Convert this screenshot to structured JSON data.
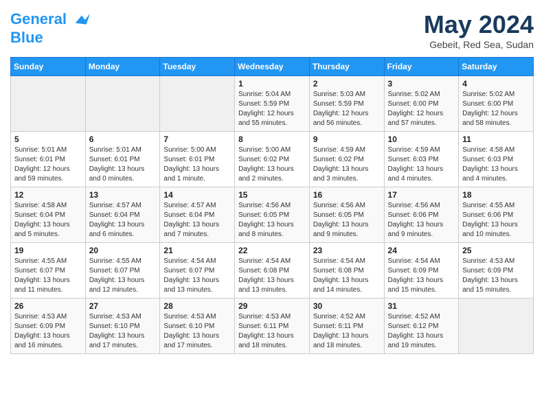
{
  "header": {
    "logo_line1": "General",
    "logo_line2": "Blue",
    "month_title": "May 2024",
    "location": "Gebeit, Red Sea, Sudan"
  },
  "weekdays": [
    "Sunday",
    "Monday",
    "Tuesday",
    "Wednesday",
    "Thursday",
    "Friday",
    "Saturday"
  ],
  "weeks": [
    [
      {
        "day": "",
        "info": ""
      },
      {
        "day": "",
        "info": ""
      },
      {
        "day": "",
        "info": ""
      },
      {
        "day": "1",
        "info": "Sunrise: 5:04 AM\nSunset: 5:59 PM\nDaylight: 12 hours\nand 55 minutes."
      },
      {
        "day": "2",
        "info": "Sunrise: 5:03 AM\nSunset: 5:59 PM\nDaylight: 12 hours\nand 56 minutes."
      },
      {
        "day": "3",
        "info": "Sunrise: 5:02 AM\nSunset: 6:00 PM\nDaylight: 12 hours\nand 57 minutes."
      },
      {
        "day": "4",
        "info": "Sunrise: 5:02 AM\nSunset: 6:00 PM\nDaylight: 12 hours\nand 58 minutes."
      }
    ],
    [
      {
        "day": "5",
        "info": "Sunrise: 5:01 AM\nSunset: 6:01 PM\nDaylight: 12 hours\nand 59 minutes."
      },
      {
        "day": "6",
        "info": "Sunrise: 5:01 AM\nSunset: 6:01 PM\nDaylight: 13 hours\nand 0 minutes."
      },
      {
        "day": "7",
        "info": "Sunrise: 5:00 AM\nSunset: 6:01 PM\nDaylight: 13 hours\nand 1 minute."
      },
      {
        "day": "8",
        "info": "Sunrise: 5:00 AM\nSunset: 6:02 PM\nDaylight: 13 hours\nand 2 minutes."
      },
      {
        "day": "9",
        "info": "Sunrise: 4:59 AM\nSunset: 6:02 PM\nDaylight: 13 hours\nand 3 minutes."
      },
      {
        "day": "10",
        "info": "Sunrise: 4:59 AM\nSunset: 6:03 PM\nDaylight: 13 hours\nand 4 minutes."
      },
      {
        "day": "11",
        "info": "Sunrise: 4:58 AM\nSunset: 6:03 PM\nDaylight: 13 hours\nand 4 minutes."
      }
    ],
    [
      {
        "day": "12",
        "info": "Sunrise: 4:58 AM\nSunset: 6:04 PM\nDaylight: 13 hours\nand 5 minutes."
      },
      {
        "day": "13",
        "info": "Sunrise: 4:57 AM\nSunset: 6:04 PM\nDaylight: 13 hours\nand 6 minutes."
      },
      {
        "day": "14",
        "info": "Sunrise: 4:57 AM\nSunset: 6:04 PM\nDaylight: 13 hours\nand 7 minutes."
      },
      {
        "day": "15",
        "info": "Sunrise: 4:56 AM\nSunset: 6:05 PM\nDaylight: 13 hours\nand 8 minutes."
      },
      {
        "day": "16",
        "info": "Sunrise: 4:56 AM\nSunset: 6:05 PM\nDaylight: 13 hours\nand 9 minutes."
      },
      {
        "day": "17",
        "info": "Sunrise: 4:56 AM\nSunset: 6:06 PM\nDaylight: 13 hours\nand 9 minutes."
      },
      {
        "day": "18",
        "info": "Sunrise: 4:55 AM\nSunset: 6:06 PM\nDaylight: 13 hours\nand 10 minutes."
      }
    ],
    [
      {
        "day": "19",
        "info": "Sunrise: 4:55 AM\nSunset: 6:07 PM\nDaylight: 13 hours\nand 11 minutes."
      },
      {
        "day": "20",
        "info": "Sunrise: 4:55 AM\nSunset: 6:07 PM\nDaylight: 13 hours\nand 12 minutes."
      },
      {
        "day": "21",
        "info": "Sunrise: 4:54 AM\nSunset: 6:07 PM\nDaylight: 13 hours\nand 13 minutes."
      },
      {
        "day": "22",
        "info": "Sunrise: 4:54 AM\nSunset: 6:08 PM\nDaylight: 13 hours\nand 13 minutes."
      },
      {
        "day": "23",
        "info": "Sunrise: 4:54 AM\nSunset: 6:08 PM\nDaylight: 13 hours\nand 14 minutes."
      },
      {
        "day": "24",
        "info": "Sunrise: 4:54 AM\nSunset: 6:09 PM\nDaylight: 13 hours\nand 15 minutes."
      },
      {
        "day": "25",
        "info": "Sunrise: 4:53 AM\nSunset: 6:09 PM\nDaylight: 13 hours\nand 15 minutes."
      }
    ],
    [
      {
        "day": "26",
        "info": "Sunrise: 4:53 AM\nSunset: 6:09 PM\nDaylight: 13 hours\nand 16 minutes."
      },
      {
        "day": "27",
        "info": "Sunrise: 4:53 AM\nSunset: 6:10 PM\nDaylight: 13 hours\nand 17 minutes."
      },
      {
        "day": "28",
        "info": "Sunrise: 4:53 AM\nSunset: 6:10 PM\nDaylight: 13 hours\nand 17 minutes."
      },
      {
        "day": "29",
        "info": "Sunrise: 4:53 AM\nSunset: 6:11 PM\nDaylight: 13 hours\nand 18 minutes."
      },
      {
        "day": "30",
        "info": "Sunrise: 4:52 AM\nSunset: 6:11 PM\nDaylight: 13 hours\nand 18 minutes."
      },
      {
        "day": "31",
        "info": "Sunrise: 4:52 AM\nSunset: 6:12 PM\nDaylight: 13 hours\nand 19 minutes."
      },
      {
        "day": "",
        "info": ""
      }
    ]
  ]
}
